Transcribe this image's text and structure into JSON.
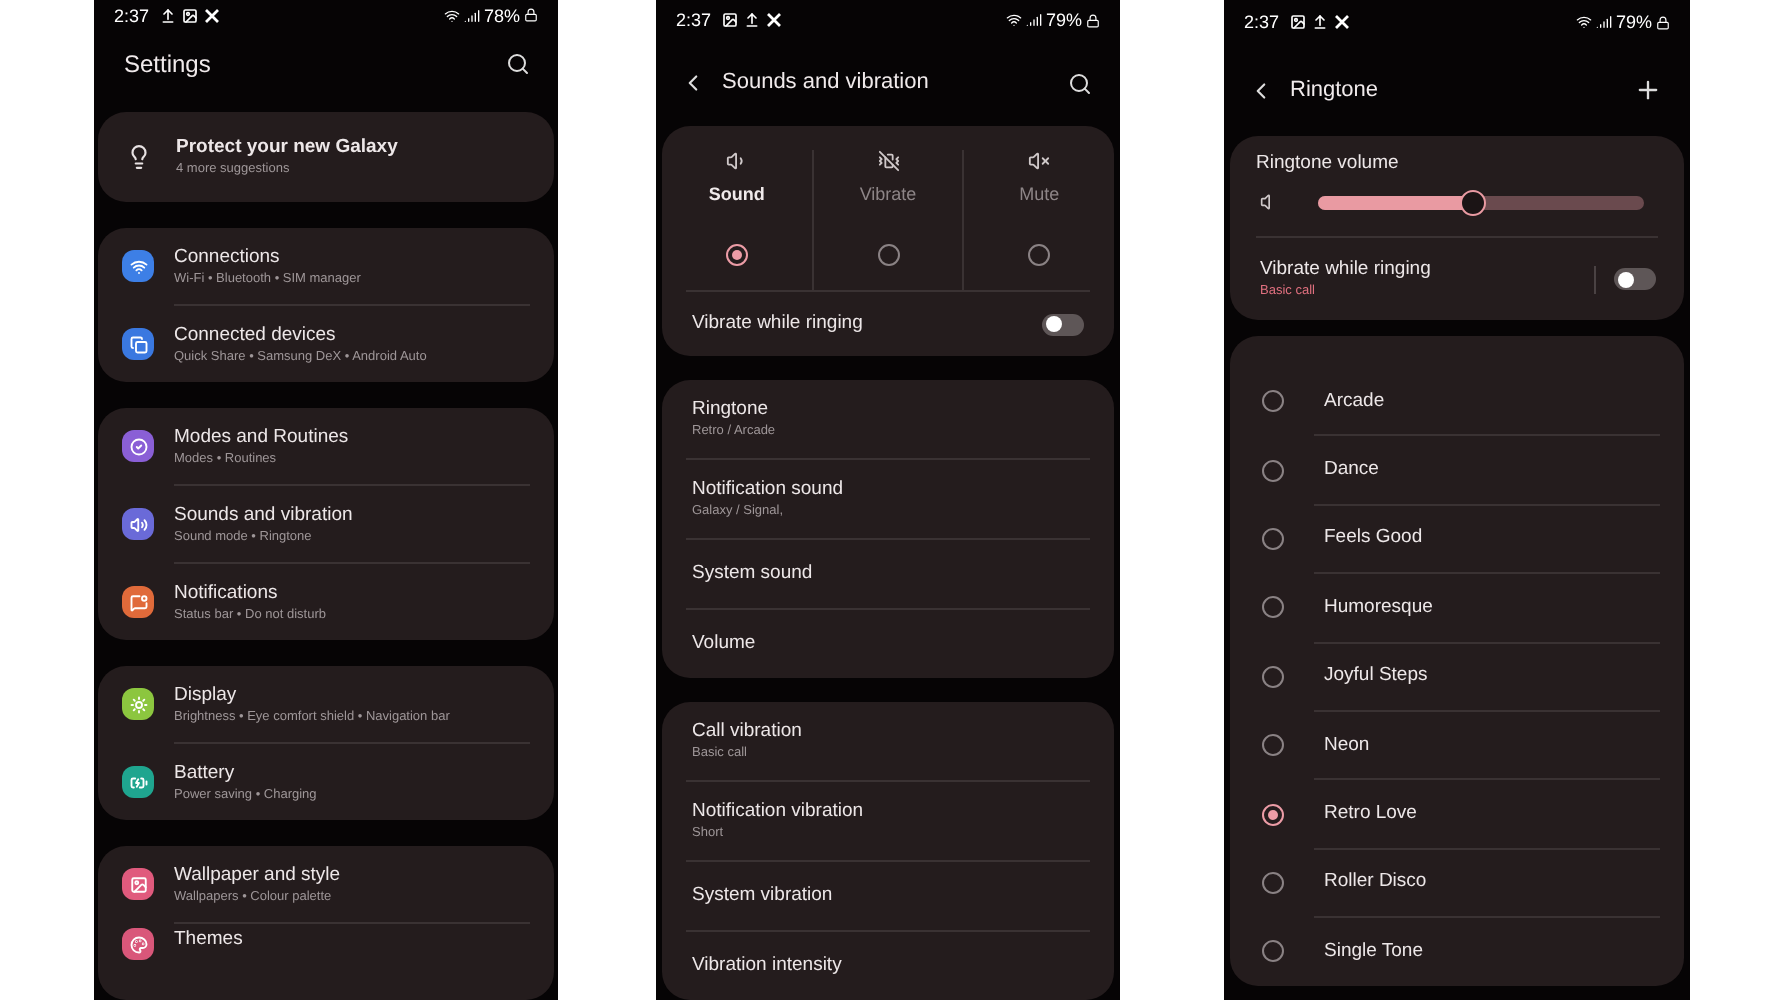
{
  "settings_screen": {
    "status_bar": {
      "time": "2:37",
      "battery": "78%"
    },
    "title": "Settings",
    "suggestion": {
      "title": "Protect your new Galaxy",
      "subtitle": "4 more suggestions"
    },
    "groups": [
      {
        "items": [
          {
            "title": "Connections",
            "subtitle": "Wi-Fi  •  Bluetooth  •  SIM manager",
            "color": "#3d7fe6"
          },
          {
            "title": "Connected devices",
            "subtitle": "Quick Share  •  Samsung DeX  •  Android Auto",
            "color": "#3a78e0"
          }
        ]
      },
      {
        "items": [
          {
            "title": "Modes and Routines",
            "subtitle": "Modes  •  Routines",
            "color": "#8a5fd6"
          },
          {
            "title": "Sounds and vibration",
            "subtitle": "Sound mode  •  Ringtone",
            "color": "#6a6ad8"
          },
          {
            "title": "Notifications",
            "subtitle": "Status bar  •  Do not disturb",
            "color": "#e06a3a"
          }
        ]
      },
      {
        "items": [
          {
            "title": "Display",
            "subtitle": "Brightness  •  Eye comfort shield  •  Navigation bar",
            "color": "#8cc63f"
          },
          {
            "title": "Battery",
            "subtitle": "Power saving  •  Charging",
            "color": "#1fa58f"
          }
        ]
      },
      {
        "items": [
          {
            "title": "Wallpaper and style",
            "subtitle": "Wallpapers  •  Colour palette",
            "color": "#e05a7d"
          },
          {
            "title": "Themes",
            "color": "#d9577a"
          }
        ]
      }
    ]
  },
  "sounds_screen": {
    "status_bar": {
      "time": "2:37",
      "battery": "79%"
    },
    "title": "Sounds and vibration",
    "modes": [
      {
        "label": "Sound",
        "selected": true
      },
      {
        "label": "Vibrate",
        "selected": false
      },
      {
        "label": "Mute",
        "selected": false
      }
    ],
    "vibrate_while_ringing": {
      "label": "Vibrate while ringing",
      "on": false
    },
    "groups": [
      {
        "items": [
          {
            "title": "Ringtone",
            "subtitle": "Retro / Arcade"
          },
          {
            "title": "Notification sound",
            "subtitle": "Galaxy / Signal,"
          },
          {
            "title": "System sound"
          },
          {
            "title": "Volume"
          }
        ]
      },
      {
        "items": [
          {
            "title": "Call vibration",
            "subtitle": "Basic call"
          },
          {
            "title": "Notification vibration",
            "subtitle": "Short"
          },
          {
            "title": "System vibration"
          },
          {
            "title": "Vibration intensity"
          }
        ]
      }
    ]
  },
  "ringtone_screen": {
    "status_bar": {
      "time": "2:37",
      "battery": "79%"
    },
    "title": "Ringtone",
    "volume": {
      "label": "Ringtone volume",
      "level": 0.47
    },
    "vibrate_while_ringing": {
      "label": "Vibrate while ringing",
      "subtitle": "Basic call",
      "on": false
    },
    "ringtones": [
      {
        "label": "Arcade",
        "selected": false
      },
      {
        "label": "Dance",
        "selected": false
      },
      {
        "label": "Feels Good",
        "selected": false
      },
      {
        "label": "Humoresque",
        "selected": false
      },
      {
        "label": "Joyful Steps",
        "selected": false
      },
      {
        "label": "Neon",
        "selected": false
      },
      {
        "label": "Retro Love",
        "selected": true
      },
      {
        "label": "Roller Disco",
        "selected": false
      },
      {
        "label": "Single Tone",
        "selected": false
      }
    ]
  }
}
